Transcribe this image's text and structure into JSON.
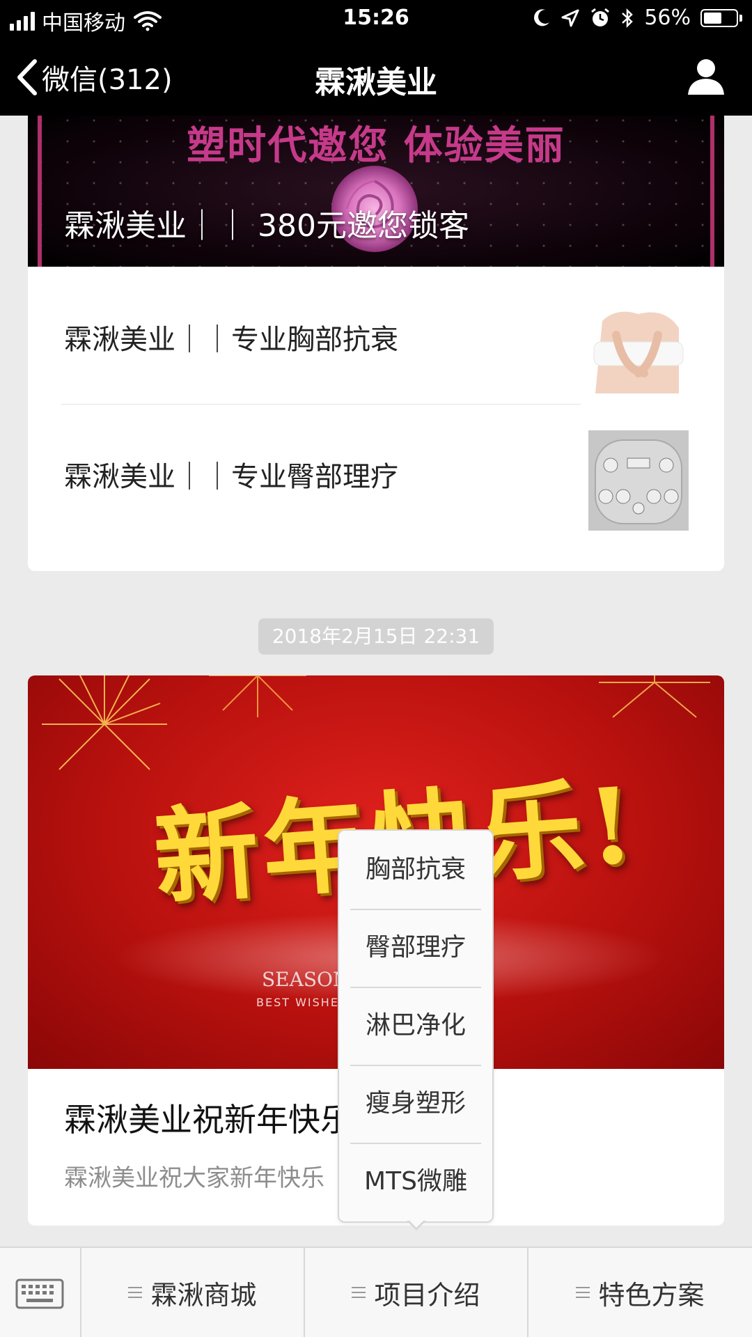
{
  "status_bar": {
    "carrier": "中国移动",
    "time": "15:26",
    "battery": "56%",
    "battery_level": 0.56
  },
  "nav": {
    "back_label": "微信(312)",
    "title": "霖湫美业"
  },
  "messages": {
    "card1": {
      "cover_slogan": "塑时代邀您  体验美丽",
      "cover_caption": "霖湫美业｜｜ 380元邀您锁客",
      "items": [
        {
          "title": "霖湫美业｜｜专业胸部抗衰"
        },
        {
          "title": "霖湫美业｜｜专业臀部理疗"
        }
      ]
    },
    "timestamp": "2018年2月15日 22:31",
    "card2": {
      "cover_headline": "新年快乐!",
      "cover_season": "SEASON",
      "cover_wishes": "BEST WISHES",
      "title": "霖湫美业祝新年快乐",
      "summary": "霖湫美业祝大家新年快乐"
    }
  },
  "popup_menu": {
    "items": [
      "胸部抗衰",
      "臀部理疗",
      "淋巴净化",
      "瘦身塑形",
      "MTS微雕"
    ]
  },
  "bottom_menu": {
    "items": [
      "霖湫商城",
      "项目介绍",
      "特色方案"
    ]
  },
  "colors": {
    "nav_background": "#000000",
    "slogan_pink": "#c63a8a",
    "new_year_red": "#c8130f",
    "headline_gold": "#ffd93a"
  }
}
